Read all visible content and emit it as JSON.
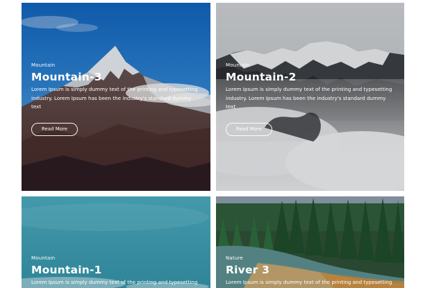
{
  "cards": [
    {
      "category": "Mountain",
      "title": "Mountain-3",
      "description": "Lorem Ipsum is simply dummy text of the printing and typesetting industry. Lorem Ipsum has been the industry's standard dummy text",
      "button_label": "Read More"
    },
    {
      "category": "Mountain",
      "title": "Mountain-2",
      "description": "Lorem Ipsum is simply dummy text of the printing and typesetting industry. Lorem Ipsum has been the industry's standard dummy text",
      "button_label": "Read More"
    },
    {
      "category": "Mountain",
      "title": "Mountain-1",
      "description": "Lorem Ipsum is simply dummy text of the printing and typesetting"
    },
    {
      "category": "Nature",
      "title": "River 3",
      "description": "Lorem Ipsum is simply dummy text of the printing and typesetting"
    }
  ],
  "colors": {
    "page_background": "#ffffff",
    "text": "#ffffff",
    "sky_blue": "#1f73c9",
    "fog_gray": "#c8cbcf",
    "teal": "#3e93a3",
    "forest_green": "#2c5a37"
  },
  "images": {
    "card_0": "snow-capped-peak-blue-sky",
    "card_1": "mountain-range-in-clouds",
    "card_2": "teal-sky-gradient",
    "card_3": "pine-forest-river"
  }
}
